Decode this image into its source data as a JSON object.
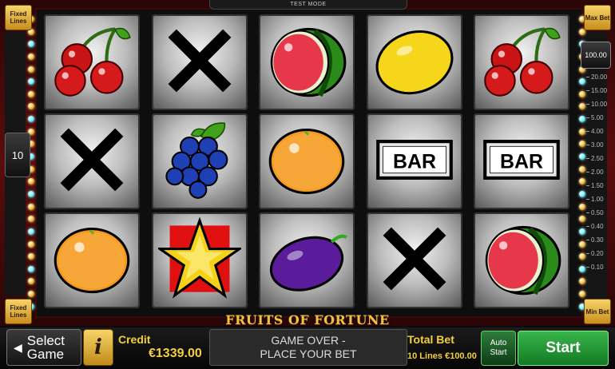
{
  "app": {
    "test_mode": "TEST MODE",
    "logo": "FRUITS OF FORTUNE"
  },
  "left": {
    "fixed_top": "Fixed Lines",
    "fixed_bottom": "Fixed Lines",
    "lines_value": "10"
  },
  "right": {
    "max_bet": "Max Bet",
    "min_bet": "Min Bet",
    "bet_value": "100.00",
    "scale": [
      "20.00",
      "15.00",
      "10.00",
      "5.00",
      "4.00",
      "3.00",
      "2.50",
      "2.00",
      "1.50",
      "1.00",
      "0.50",
      "0.40",
      "0.30",
      "0.20",
      "0.10"
    ]
  },
  "reels": [
    [
      "cherry-icon",
      "x-icon",
      "orange-icon"
    ],
    [
      "x-icon",
      "grapes-icon",
      "star-icon"
    ],
    [
      "watermelon-icon",
      "orange-icon",
      "plum-icon"
    ],
    [
      "lemon-icon",
      "bar-icon",
      "x-icon"
    ],
    [
      "cherry-icon",
      "bar-icon",
      "watermelon-icon"
    ]
  ],
  "bar_text": "BAR",
  "bottom": {
    "select_label": "Select Game",
    "info_label": "i",
    "credit_label": "Credit",
    "credit_value": "€1339.00",
    "message_line1": "GAME OVER -",
    "message_line2": "PLACE YOUR BET",
    "total_bet_label": "Total Bet",
    "total_bet_value": "10 Lines €100.00",
    "auto_label": "Auto",
    "auto_label2": "Start",
    "start_label": "Start"
  },
  "colors": {
    "accent_gold": "#f4d13a",
    "frame_red": "#5a0d0d",
    "start_green": "#39b54a"
  }
}
